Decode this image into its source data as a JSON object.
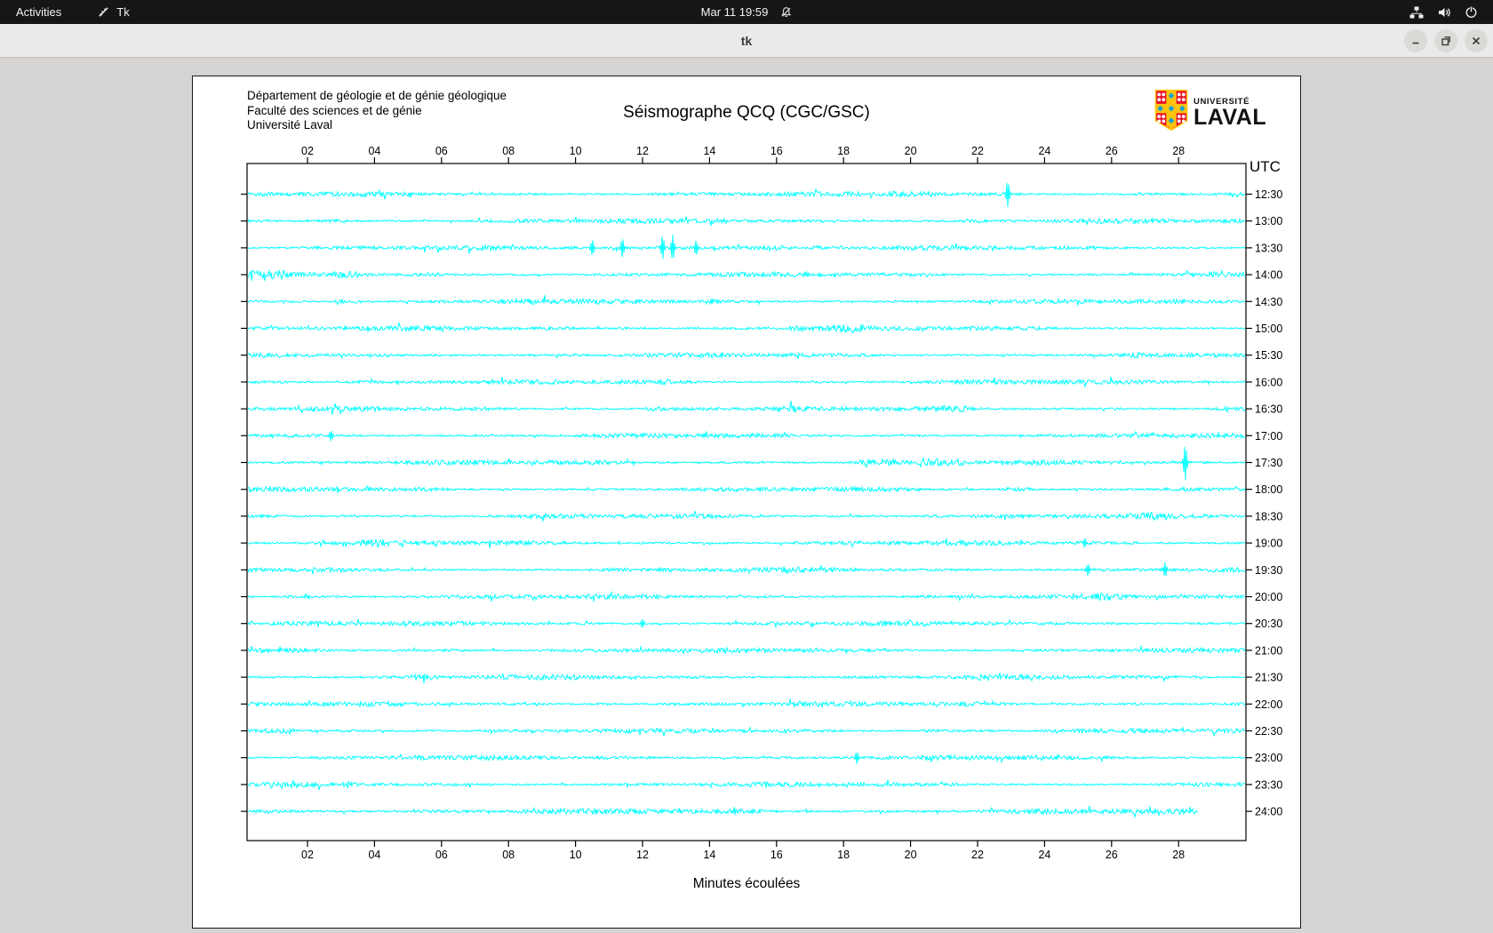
{
  "topbar": {
    "activities_label": "Activities",
    "app_name": "Tk",
    "clock": "Mar 11 19:59",
    "icons": [
      "tk-app-icon",
      "bell-slash-icon",
      "network-icon",
      "volume-icon",
      "power-icon"
    ]
  },
  "window": {
    "title": "tk",
    "controls": [
      "minimize",
      "restore",
      "close"
    ]
  },
  "panel": {
    "dept_lines": [
      "Département de géologie et de génie géologique",
      "Faculté des sciences et de génie",
      "Université Laval"
    ],
    "title": "Séismographe QCQ (CGC/GSC)",
    "logo": {
      "line1": "UNIVERSITÉ",
      "line2": "LAVAL"
    }
  },
  "chart_data": {
    "type": "line",
    "title": "Séismographe QCQ (CGC/GSC)",
    "xlabel": "Minutes écoulées",
    "right_axis_label": "UTC",
    "x_range": [
      0,
      30
    ],
    "x_tick_minutes": [
      2,
      4,
      6,
      8,
      10,
      12,
      14,
      16,
      18,
      20,
      22,
      24,
      26,
      28
    ],
    "x_tick_labels": [
      "02",
      "04",
      "06",
      "08",
      "10",
      "12",
      "14",
      "16",
      "18",
      "20",
      "22",
      "24",
      "26",
      "28"
    ],
    "row_interval_minutes": 30,
    "trace_color": "#00ffff",
    "utc_color": "#ff0000",
    "grid": false,
    "rows": [
      {
        "label": "12:30",
        "events": [
          {
            "m": 22.9,
            "a": 15
          }
        ],
        "spans": [
          {
            "f": 19.3,
            "t": 20.8,
            "k": 1.7
          },
          {
            "f": 22.4,
            "t": 23.4,
            "k": 1.4
          }
        ]
      },
      {
        "label": "13:00",
        "events": [],
        "spans": [
          {
            "f": 2.3,
            "t": 3.1,
            "k": 1.8
          },
          {
            "f": 14.0,
            "t": 14.5,
            "k": 1.5
          }
        ]
      },
      {
        "label": "13:30",
        "events": [
          {
            "m": 10.5,
            "a": 9
          },
          {
            "m": 11.4,
            "a": 10
          },
          {
            "m": 12.6,
            "a": 13
          },
          {
            "m": 12.9,
            "a": 14
          },
          {
            "m": 13.6,
            "a": 8
          }
        ],
        "spans": [
          {
            "f": 9.8,
            "t": 10.2,
            "k": 1.5
          },
          {
            "f": 12.4,
            "t": 16.2,
            "k": 2.0
          },
          {
            "f": 17.0,
            "t": 17.5,
            "k": 1.5
          }
        ]
      },
      {
        "label": "14:00",
        "events": [],
        "spans": [
          {
            "f": 0.2,
            "t": 1.3,
            "k": 1.9
          },
          {
            "f": 2.7,
            "t": 3.5,
            "k": 1.8
          },
          {
            "f": 5.1,
            "t": 5.9,
            "k": 1.6
          },
          {
            "f": 8.2,
            "t": 8.6,
            "k": 1.5
          }
        ]
      },
      {
        "label": "14:30",
        "events": [],
        "spans": [
          {
            "f": 2.8,
            "t": 3.6,
            "k": 1.9
          },
          {
            "f": 7.7,
            "t": 9.1,
            "k": 1.6
          },
          {
            "f": 13.9,
            "t": 14.3,
            "k": 1.5
          }
        ]
      },
      {
        "label": "15:00",
        "events": [],
        "spans": [
          {
            "f": 11.3,
            "t": 11.7,
            "k": 1.5
          },
          {
            "f": 16.4,
            "t": 18.6,
            "k": 1.9
          }
        ]
      },
      {
        "label": "15:30",
        "events": [],
        "spans": [
          {
            "f": 5.5,
            "t": 6.0,
            "k": 1.4
          },
          {
            "f": 26.5,
            "t": 27.0,
            "k": 1.4
          }
        ]
      },
      {
        "label": "16:00",
        "events": [],
        "spans": [
          {
            "f": 0.3,
            "t": 1.4,
            "k": 1.6
          },
          {
            "f": 12.5,
            "t": 13.0,
            "k": 1.4
          }
        ]
      },
      {
        "label": "16:30",
        "events": [],
        "spans": [
          {
            "f": 12.1,
            "t": 14.3,
            "k": 1.8
          },
          {
            "f": 15.9,
            "t": 16.6,
            "k": 1.6
          },
          {
            "f": 20.9,
            "t": 21.7,
            "k": 1.6
          },
          {
            "f": 25.8,
            "t": 26.3,
            "k": 1.5
          }
        ]
      },
      {
        "label": "17:00",
        "events": [
          {
            "m": 2.7,
            "a": 6
          }
        ],
        "spans": [
          {
            "f": 26.8,
            "t": 27.3,
            "k": 1.5
          }
        ]
      },
      {
        "label": "17:30",
        "events": [
          {
            "m": 28.2,
            "a": 20
          }
        ],
        "spans": [
          {
            "f": 18.3,
            "t": 19.6,
            "k": 1.8
          },
          {
            "f": 20.3,
            "t": 21.6,
            "k": 2.0
          },
          {
            "f": 25.9,
            "t": 26.4,
            "k": 1.5
          }
        ]
      },
      {
        "label": "18:00",
        "events": [],
        "spans": [
          {
            "f": 6.5,
            "t": 7.0,
            "k": 1.4
          },
          {
            "f": 22.8,
            "t": 23.6,
            "k": 1.7
          }
        ]
      },
      {
        "label": "18:30",
        "events": [],
        "spans": [
          {
            "f": 3.0,
            "t": 3.5,
            "k": 1.4
          },
          {
            "f": 20.4,
            "t": 21.3,
            "k": 1.7
          },
          {
            "f": 26.9,
            "t": 27.4,
            "k": 1.5
          }
        ]
      },
      {
        "label": "19:00",
        "events": [
          {
            "m": 25.2,
            "a": 5
          }
        ],
        "spans": [
          {
            "f": 3.4,
            "t": 4.3,
            "k": 1.7
          },
          {
            "f": 24.9,
            "t": 25.6,
            "k": 1.5
          }
        ]
      },
      {
        "label": "19:30",
        "events": [
          {
            "m": 25.3,
            "a": 7
          },
          {
            "m": 27.6,
            "a": 8
          }
        ],
        "spans": [
          {
            "f": 10.4,
            "t": 11.3,
            "k": 1.6
          },
          {
            "f": 16.2,
            "t": 16.7,
            "k": 1.4
          }
        ]
      },
      {
        "label": "20:00",
        "events": [],
        "spans": [
          {
            "f": 1.4,
            "t": 2.1,
            "k": 1.8
          },
          {
            "f": 14.5,
            "t": 15.0,
            "k": 1.4
          },
          {
            "f": 25.4,
            "t": 26.3,
            "k": 1.6
          }
        ]
      },
      {
        "label": "20:30",
        "events": [
          {
            "m": 12.0,
            "a": 5
          }
        ],
        "spans": [
          {
            "f": 25.7,
            "t": 26.2,
            "k": 1.5
          }
        ]
      },
      {
        "label": "21:00",
        "events": [],
        "spans": [
          {
            "f": 5.9,
            "t": 6.7,
            "k": 1.7
          },
          {
            "f": 16.4,
            "t": 17.1,
            "k": 1.5
          }
        ]
      },
      {
        "label": "21:30",
        "events": [],
        "spans": [
          {
            "f": 5.1,
            "t": 5.8,
            "k": 1.5
          },
          {
            "f": 22.0,
            "t": 22.5,
            "k": 1.4
          }
        ]
      },
      {
        "label": "22:00",
        "events": [],
        "spans": [
          {
            "f": 10.5,
            "t": 11.0,
            "k": 1.4
          },
          {
            "f": 21.5,
            "t": 22.0,
            "k": 1.4
          }
        ]
      },
      {
        "label": "22:30",
        "events": [],
        "spans": [
          {
            "f": 0.7,
            "t": 1.6,
            "k": 2.1
          },
          {
            "f": 20.4,
            "t": 21.4,
            "k": 1.6
          }
        ]
      },
      {
        "label": "23:00",
        "events": [
          {
            "m": 18.4,
            "a": 7
          }
        ],
        "spans": [
          {
            "f": 5.0,
            "t": 5.5,
            "k": 1.4
          },
          {
            "f": 23.5,
            "t": 24.0,
            "k": 1.4
          }
        ]
      },
      {
        "label": "23:30",
        "events": [],
        "spans": [
          {
            "f": 0.9,
            "t": 1.7,
            "k": 1.7
          },
          {
            "f": 21.2,
            "t": 21.8,
            "k": 1.5
          }
        ]
      },
      {
        "label": "24:00",
        "events": [],
        "spans": [],
        "base": 2.5,
        "end": 28.6
      }
    ]
  }
}
